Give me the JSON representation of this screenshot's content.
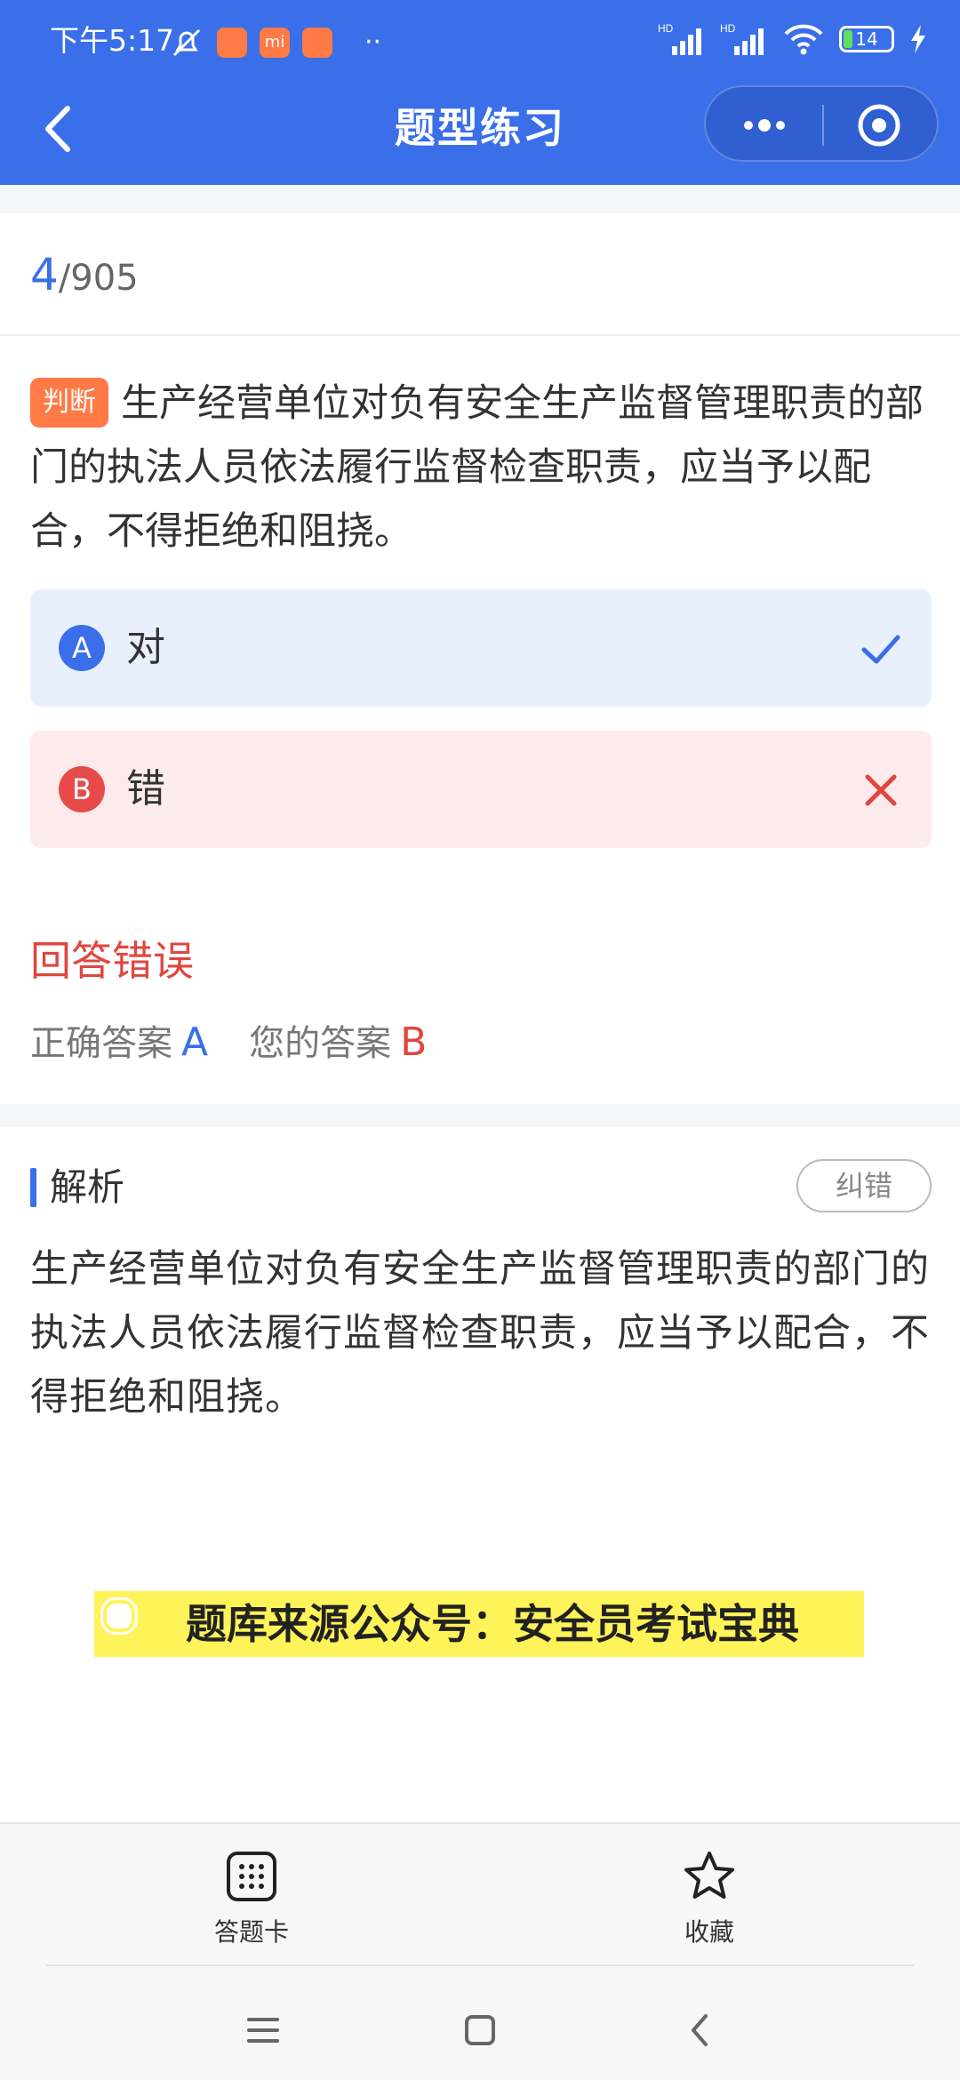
{
  "status_bar": {
    "time": "下午5:17",
    "app_badges": [
      "",
      "mi",
      ""
    ],
    "more": "··",
    "signal_1": "HD",
    "signal_2": "HD",
    "battery": "14"
  },
  "nav": {
    "title": "题型练习"
  },
  "progress": {
    "current": "4",
    "total": "/905"
  },
  "question": {
    "type_badge": "判断",
    "text": "生产经营单位对负有安全生产监督管理职责的部门的执法人员依法履行监督检查职责，应当予以配合，不得拒绝和阻挠。"
  },
  "options": [
    {
      "letter": "A",
      "text": "对",
      "state": "correct"
    },
    {
      "letter": "B",
      "text": "错",
      "state": "wrong"
    }
  ],
  "result": {
    "title": "回答错误",
    "correct_label": "正确答案",
    "correct_value": "A",
    "yours_label": "您的答案",
    "yours_value": "B"
  },
  "analysis": {
    "title": "解析",
    "report_button": "纠错",
    "body": "生产经营单位对负有安全生产监督管理职责的部门的执法人员依法履行监督检查职责，应当予以配合，不得拒绝和阻挠。"
  },
  "banner": {
    "text": "题库来源公众号：安全员考试宝典"
  },
  "bottom_tabs": {
    "answer_card": "答题卡",
    "favorite": "收藏"
  },
  "colors": {
    "primary": "#3a6fe9",
    "error": "#e0463f",
    "badge": "#ff7a45",
    "banner": "#fff35a"
  }
}
